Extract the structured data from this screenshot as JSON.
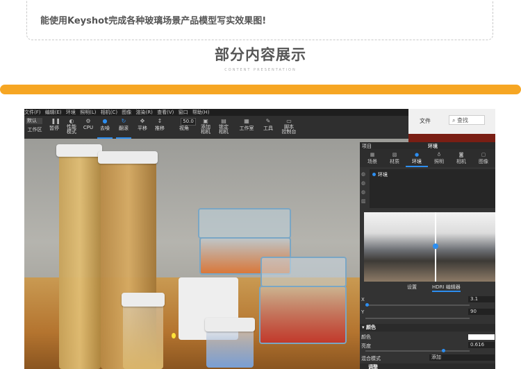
{
  "top_note": "能使用Keyshot完成各种玻璃场景产品模型写实效果图!",
  "section": {
    "title": "部分内容展示",
    "subtitle": "CONTENT PRESENTATION"
  },
  "colors": {
    "accent_bar": "#f6a623",
    "highlight": "#2d8ef0"
  },
  "app": {
    "menu": [
      "文件(F)",
      "编辑(E)",
      "环境",
      "照明(L)",
      "相机(C)",
      "图像",
      "渲染(R)",
      "查看(V)",
      "窗口",
      "帮助(H)"
    ],
    "toolbar": {
      "workspace_select": "默认",
      "workspace": "工作区",
      "pause": "暂停",
      "performance_mode": "性能\n模式",
      "cpu": "CPU",
      "denoise": "去噪",
      "tumble": "翻滚",
      "pan": "平移",
      "dolly": "推移",
      "fov_value": "50.0",
      "fov_label": "视角",
      "add_camera": "添加\n相机",
      "lock_camera": "锁定\n相机",
      "studio": "工作室",
      "tools": "工具",
      "script_console": "脚本\n控制台"
    },
    "explorer": {
      "file": "文件",
      "search": "查找"
    },
    "panel": {
      "header_left": "项目",
      "header_title": "环境",
      "tabs": [
        "场景",
        "材质",
        "环境",
        "照明",
        "相机",
        "图像"
      ],
      "env_item": "环境",
      "subtabs": [
        "设置",
        "HDRI 编辑器"
      ],
      "x_label": "X",
      "x_value": "3.1",
      "y_label": "Y",
      "y_value": "90",
      "color_section": "颜色",
      "color_label": "颜色",
      "brightness_label": "亮度",
      "brightness_value": "0.616",
      "blend_label": "混合模式",
      "blend_value": "添加",
      "next_section": "调整"
    }
  }
}
